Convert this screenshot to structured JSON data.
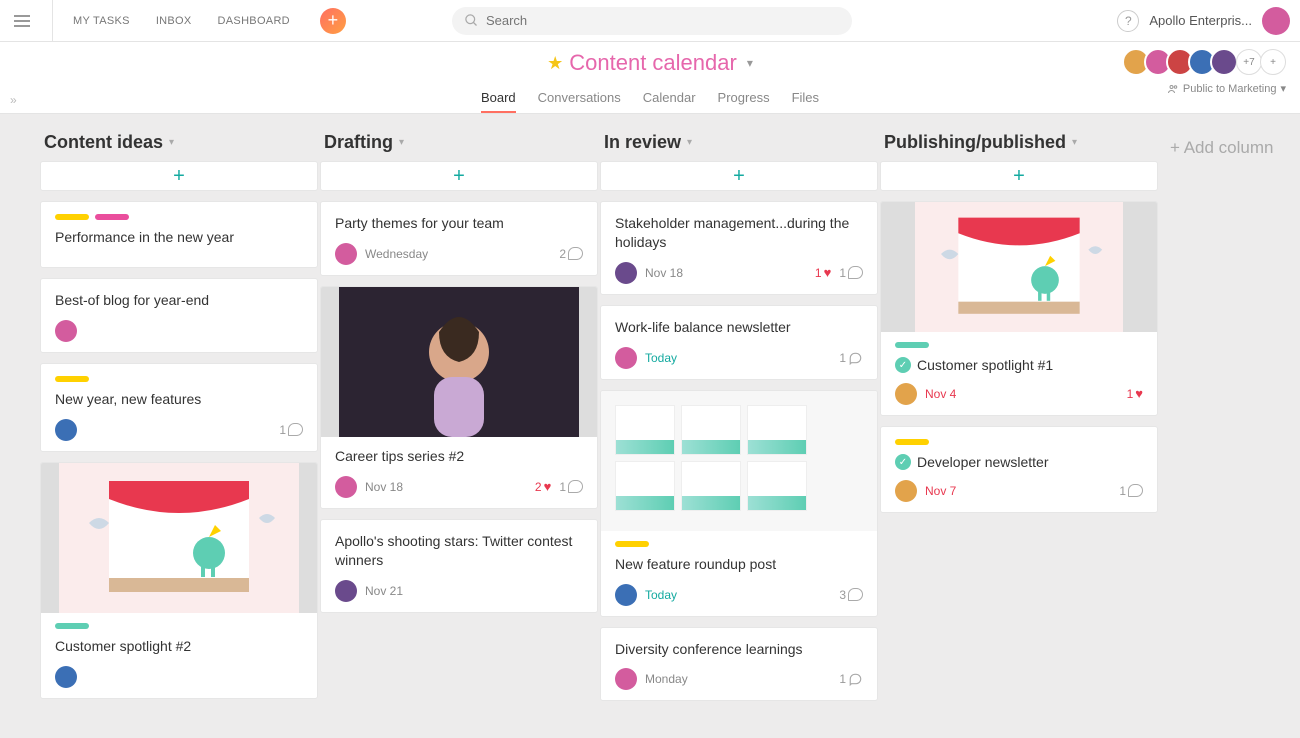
{
  "topnav": {
    "my_tasks": "MY TASKS",
    "inbox": "INBOX",
    "dashboard": "DASHBOARD"
  },
  "search": {
    "placeholder": "Search"
  },
  "workspace": "Apollo Enterpris...",
  "project": {
    "title": "Content calendar",
    "tabs": [
      "Board",
      "Conversations",
      "Calendar",
      "Progress",
      "Files"
    ],
    "active_tab": 0,
    "extra_members": "+7",
    "privacy": "Public to Marketing"
  },
  "add_column": "+ Add column",
  "columns": [
    {
      "title": "Content ideas",
      "cards": [
        {
          "tags": [
            "#ffd100",
            "#ea4e9d"
          ],
          "title": "Performance in the new year"
        },
        {
          "title": "Best-of blog for year-end",
          "avatar": "av-a"
        },
        {
          "tags": [
            "#ffd100"
          ],
          "title": "New year, new features",
          "avatar": "av-b",
          "comments": 1
        },
        {
          "cover": "stage",
          "tags": [
            "#5eceb3"
          ],
          "title": "Customer spotlight #2",
          "avatar": "av-b"
        }
      ]
    },
    {
      "title": "Drafting",
      "cards": [
        {
          "title": "Party themes for your team",
          "avatar": "av-a",
          "date": "Wednesday",
          "comments": 2
        },
        {
          "cover": "photo",
          "title": "Career tips series #2",
          "avatar": "av-a",
          "date": "Nov 18",
          "likes": 2,
          "comments": 1
        },
        {
          "title": "Apollo's shooting stars: Twitter contest winners",
          "avatar": "av-d",
          "date": "Nov 21"
        }
      ]
    },
    {
      "title": "In review",
      "cards": [
        {
          "title": "Stakeholder management...during the holidays",
          "avatar": "av-d",
          "date": "Nov 18",
          "likes": 1,
          "comments": 1
        },
        {
          "title": "Work-life balance newsletter",
          "avatar": "av-a",
          "date": "Today",
          "date_class": "date-today",
          "comments_outline": 1
        },
        {
          "cover": "dash",
          "tags": [
            "#ffd100"
          ],
          "title": "New feature roundup post",
          "avatar": "av-b",
          "date": "Today",
          "date_class": "date-today",
          "comments": 3
        },
        {
          "title": "Diversity conference learnings",
          "avatar": "av-a",
          "date": "Monday",
          "comments_outline": 1
        }
      ]
    },
    {
      "title": "Publishing/published",
      "cards": [
        {
          "cover": "stage2",
          "tags": [
            "#5eceb3"
          ],
          "done": true,
          "title": "Customer spotlight #1",
          "avatar": "av-c",
          "date": "Nov 4",
          "date_class": "date-red",
          "likes": 1
        },
        {
          "tags": [
            "#ffd100"
          ],
          "done": true,
          "title": "Developer newsletter",
          "avatar": "av-c",
          "date": "Nov 7",
          "date_class": "date-red",
          "comments": 1
        }
      ]
    }
  ]
}
